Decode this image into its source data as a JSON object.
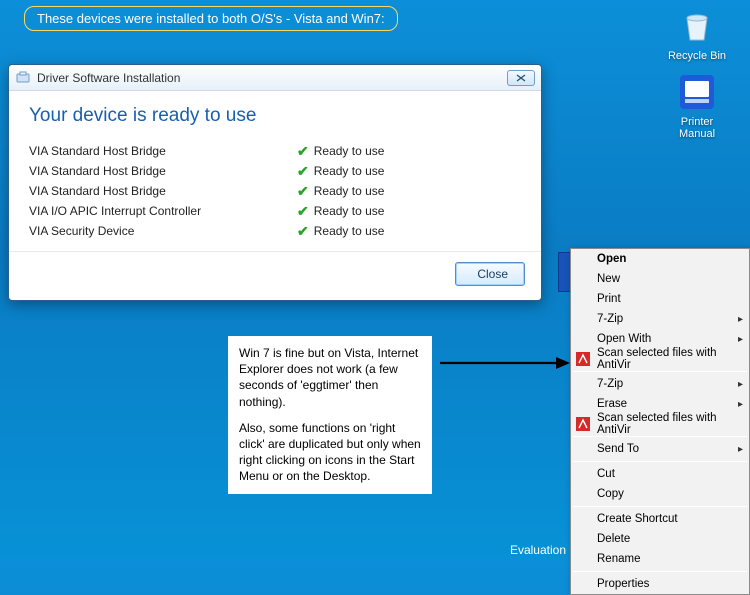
{
  "annotation_top": "These devices were installed to both O/S's - Vista and Win7:",
  "desktop": {
    "recycle": "Recycle Bin",
    "printer_l1": "Printer",
    "printer_l2": "Manual"
  },
  "dialog": {
    "title": "Driver Software Installation",
    "headline": "Your device is ready to use",
    "devices": [
      {
        "name": "VIA Standard Host Bridge",
        "status": "Ready to use"
      },
      {
        "name": "VIA Standard Host Bridge",
        "status": "Ready to use"
      },
      {
        "name": "VIA Standard Host Bridge",
        "status": "Ready to use"
      },
      {
        "name": "VIA I/O APIC Interrupt Controller",
        "status": "Ready to use"
      },
      {
        "name": "VIA Security Device",
        "status": "Ready to use"
      }
    ],
    "close_button": "Close"
  },
  "note": {
    "p1": "Win 7 is fine but on Vista, Internet Explorer does not work (a few seconds of 'eggtimer' then nothing).",
    "p2": "Also, some functions on 'right click' are duplicated but only when right clicking on icons in the Start Menu or on the Desktop."
  },
  "context_menu": [
    {
      "label": "Open",
      "bold": true
    },
    {
      "label": "New"
    },
    {
      "label": "Print"
    },
    {
      "label": "7-Zip",
      "submenu": true
    },
    {
      "label": "Open With",
      "submenu": true
    },
    {
      "label": "Scan selected files with AntiVir",
      "icon": "antivir"
    },
    {
      "sep": true
    },
    {
      "label": "7-Zip",
      "submenu": true
    },
    {
      "label": "Erase",
      "submenu": true
    },
    {
      "label": "Scan selected files with AntiVir",
      "icon": "antivir"
    },
    {
      "sep": true
    },
    {
      "label": "Send To",
      "submenu": true
    },
    {
      "sep": true
    },
    {
      "label": "Cut"
    },
    {
      "label": "Copy"
    },
    {
      "sep": true
    },
    {
      "label": "Create Shortcut"
    },
    {
      "label": "Delete"
    },
    {
      "label": "Rename"
    },
    {
      "sep": true
    },
    {
      "label": "Properties"
    }
  ],
  "evaluation": "Evaluation"
}
